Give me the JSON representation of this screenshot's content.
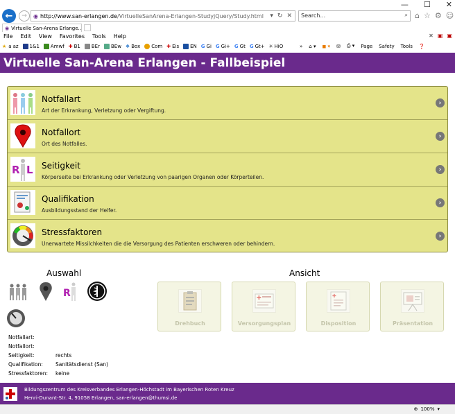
{
  "browser": {
    "url_host": "http://www.san-erlangen.de",
    "url_path": "/VirtuelleSanArena-Erlangen-StudyjQuery/Study.html",
    "search_placeholder": "Search...",
    "tab_title": "Virtuelle San-Arena Erlange...",
    "menu": [
      "File",
      "Edit",
      "View",
      "Favorites",
      "Tools",
      "Help"
    ],
    "favorites": [
      "az",
      "1&1",
      "Amwf",
      "B1",
      "BEr",
      "BEw",
      "Box",
      "Com",
      "Eis",
      "EN",
      "Gi",
      "Gi+",
      "Gt",
      "Gt+",
      "HiO"
    ],
    "commands": [
      "Page",
      "Safety",
      "Tools"
    ],
    "zoom": "100%"
  },
  "page": {
    "title": "Virtuelle San-Arena Erlangen - Fallbeispiel",
    "items": [
      {
        "title": "Notfallart",
        "desc": "Art der Erkrankung, Verletzung oder Vergiftung."
      },
      {
        "title": "Notfallort",
        "desc": "Ort des Notfalles."
      },
      {
        "title": "Seitigkeit",
        "desc": "Körperseite bei Erkrankung oder Verletzung von paarigen Organen oder Körperteilen."
      },
      {
        "title": "Qualifikation",
        "desc": "Ausbildungsstand der Helfer."
      },
      {
        "title": "Stressfaktoren",
        "desc": "Unerwartete Missilchkeiten die die Versorgung des Patienten erschweren oder behindern."
      }
    ],
    "auswahl_title": "Auswahl",
    "ansicht_title": "Ansicht",
    "info": [
      {
        "label": "Notfallart:",
        "value": ""
      },
      {
        "label": "Notfallort:",
        "value": ""
      },
      {
        "label": "Seitigkeit:",
        "value": "rechts"
      },
      {
        "label": "Qualifikation:",
        "value": "Sanitätsdienst (San)"
      },
      {
        "label": "Stressfaktoren:",
        "value": "keine"
      }
    ],
    "views": [
      "Drehbuch",
      "Versorgungsplan",
      "Disposition",
      "Präsentation"
    ]
  },
  "footer": {
    "line1": "Bildungszentrum des Kreisverbandes Erlangen-Höchstadt im Bayerischen Roten Kreuz",
    "line2": "Henri-Dunant-Str. 4, 91058 Erlangen, san-erlangen@thumsi.de"
  },
  "colors": {
    "header": "#6a2a8c",
    "menu_bg": "#e4e48a",
    "view_bg": "#f4f5e3"
  }
}
